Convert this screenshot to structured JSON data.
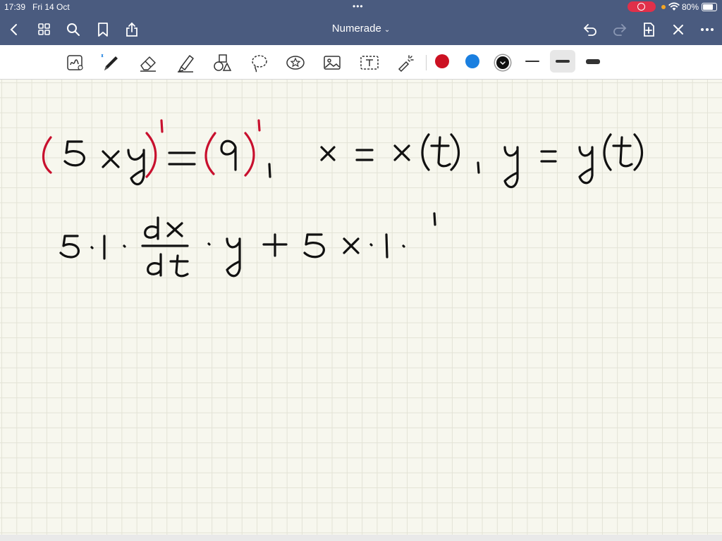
{
  "status_bar": {
    "time": "17:39",
    "date": "Fri 14 Oct",
    "battery": "80%",
    "battery_level": 0.8
  },
  "nav_bar": {
    "title": "Numerade",
    "icons": [
      "back-icon",
      "grid-icon",
      "search-icon",
      "bookmark-icon",
      "share-icon",
      "undo-icon",
      "redo-icon",
      "add-page-icon",
      "close-icon",
      "more-icon"
    ]
  },
  "toolbar": {
    "tools": [
      "handwriting-recognition",
      "pen",
      "eraser",
      "highlighter",
      "shapes",
      "lasso",
      "sticker",
      "image",
      "text",
      "laser-pointer"
    ],
    "colors": [
      "#cc1122",
      "#1a7fe0",
      "#111111"
    ],
    "selected_color": "#111111",
    "stroke_widths": [
      "thin",
      "medium",
      "thick"
    ],
    "selected_stroke": "medium",
    "accent": "#4a5b7f"
  },
  "canvas": {
    "paper": "grid",
    "line1": "(5xy)' = (9)', x = x(t), y = y(t)",
    "line2": "5·1·dx/dt·y + 5x·1· '",
    "ink_colors": {
      "red": "#c8102e",
      "black": "#111111"
    }
  }
}
